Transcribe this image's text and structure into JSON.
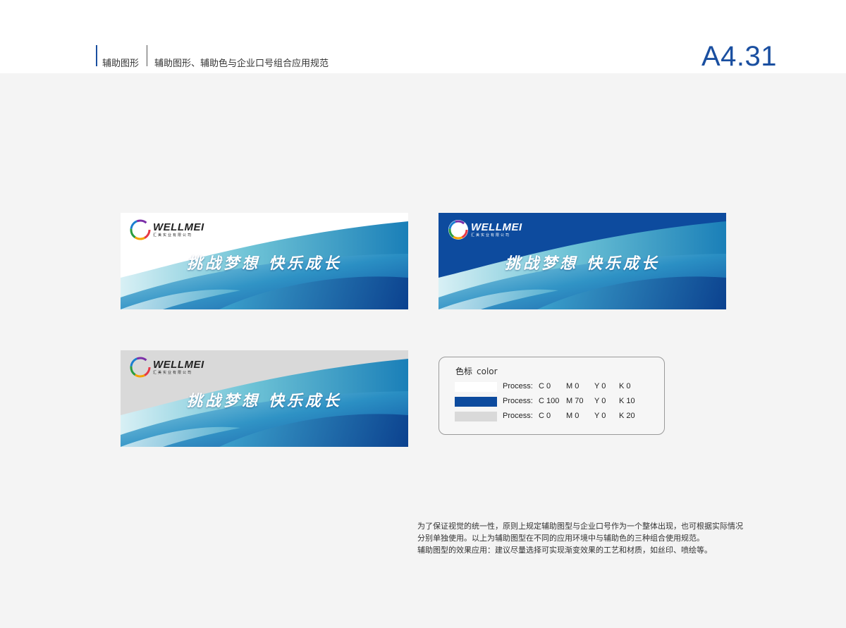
{
  "header": {
    "section": "辅助图形",
    "subtitle": "辅助图形、辅助色与企业口号组合应用规范",
    "page_code": "A4.31"
  },
  "brand": {
    "name": "WELLMEI",
    "sub": "汇美实业有限公司"
  },
  "slogan": "挑战梦想  快乐成长",
  "banners": [
    {
      "variant": "white background",
      "background": "#ffffff"
    },
    {
      "variant": "blue background",
      "background": "#0d4b9e"
    },
    {
      "variant": "gray background",
      "background": "#d9d9d9"
    }
  ],
  "legend": {
    "title_cn": "色标",
    "title_en": "color",
    "rows": [
      {
        "swatch": "#ffffff",
        "label": "Process:",
        "c": "C 0",
        "m": "M 0",
        "y": "Y 0",
        "k": "K 0"
      },
      {
        "swatch": "#0d4b9e",
        "label": "Process:",
        "c": "C 100",
        "m": "M 70",
        "y": "Y 0",
        "k": "K 10"
      },
      {
        "swatch": "#d9d9d9",
        "label": "Process:",
        "c": "C 0",
        "m": "M 0",
        "y": "Y 0",
        "k": "K 20"
      }
    ]
  },
  "notes": [
    "为了保证视觉的统一性，原则上规定辅助图型与企业口号作为一个整体出现，也可根据实际情况",
    "分别单独使用。以上为辅助图型在不同的应用环境中与辅助色的三种组合使用规范。",
    "辅助图型的效果应用：建议尽量选择可实现渐变效果的工艺和材质，如丝印、喷绘等。"
  ],
  "colors": {
    "accent": "#1a4fa0",
    "wave_dark": "#0d4b9e",
    "wave_light": "#cfe9f2"
  }
}
